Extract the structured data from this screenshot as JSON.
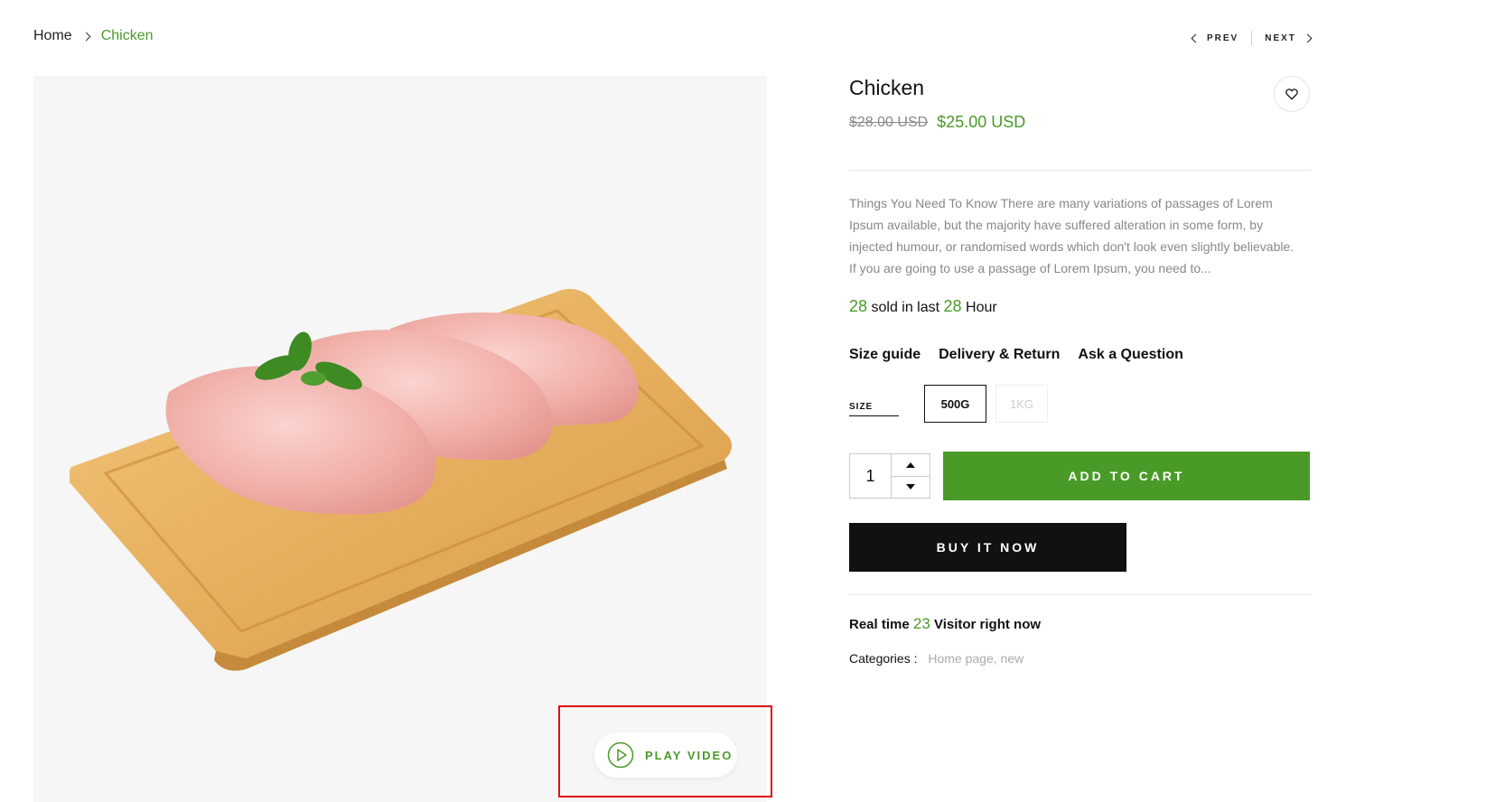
{
  "breadcrumb": {
    "home": "Home",
    "current": "Chicken"
  },
  "pager": {
    "prev": "PREV",
    "next": "NEXT"
  },
  "gallery": {
    "play_video": "PLAY VIDEO"
  },
  "product": {
    "title": "Chicken",
    "old_price": "$28.00 USD",
    "price": "$25.00 USD",
    "description": "Things You Need To Know There are many variations of passages of Lorem Ipsum available, but the majority have suffered alteration in some form, by injected humour, or randomised words which don't look even slightly believable. If you are going to use a passage of Lorem Ipsum, you need to...",
    "sold": {
      "count": "28",
      "text_mid": "sold in last",
      "hours": "28",
      "text_end": "Hour"
    },
    "links": {
      "size_guide": "Size guide",
      "delivery": "Delivery & Return",
      "ask": "Ask a Question"
    },
    "size": {
      "label": "SIZE",
      "options": [
        "500G",
        "1KG"
      ],
      "selected": "500G"
    },
    "quantity": "1",
    "add_to_cart": "ADD TO CART",
    "buy_now": "BUY IT NOW",
    "visitors": {
      "prefix": "Real time",
      "count": "23",
      "suffix": "Visitor right now"
    },
    "categories": {
      "label": "Categories :",
      "values": "Home page, new"
    }
  },
  "colors": {
    "accent": "#4a9a28",
    "dark": "#111111",
    "highlight_box": "#e01010"
  }
}
